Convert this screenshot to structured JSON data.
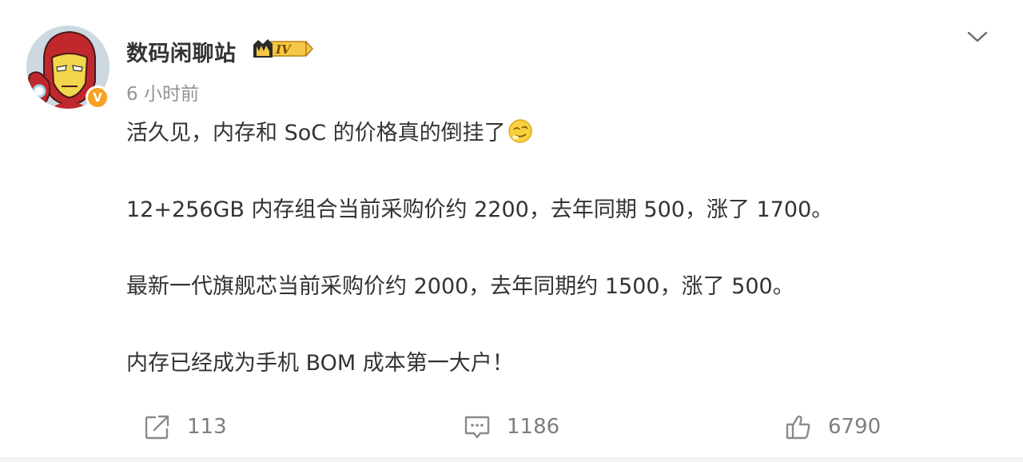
{
  "post": {
    "author": {
      "name": "数码闲聊站",
      "level_badge": "IV",
      "verified_badge": "V",
      "avatar_icon": "ironman-avatar-icon"
    },
    "timestamp": "6 小时前",
    "paragraphs": {
      "p1": "活久见，内存和 SoC 的价格真的倒挂了",
      "p2": "12+256GB 内存组合当前采购价约 2200，去年同期 500，涨了 1700。",
      "p3": "最新一代旗舰芯当前采购价约 2000，去年同期约 1500，涨了 500。",
      "p4": "内存已经成为手机 BOM 成本第一大户！"
    },
    "p1_emoji": "doge-emoji-icon",
    "actions": {
      "repost_count": "113",
      "comment_count": "1186",
      "like_count": "6790"
    },
    "icons": {
      "repost": "share-arrow-icon",
      "comment": "comment-bubble-icon",
      "like": "thumbs-up-icon",
      "menu": "chevron-down-icon"
    },
    "colors": {
      "text": "#333333",
      "muted": "#939393",
      "action_gray": "#7e7e7e",
      "verified_orange": "#f7a125",
      "badge_gold": "#f5c518"
    }
  }
}
